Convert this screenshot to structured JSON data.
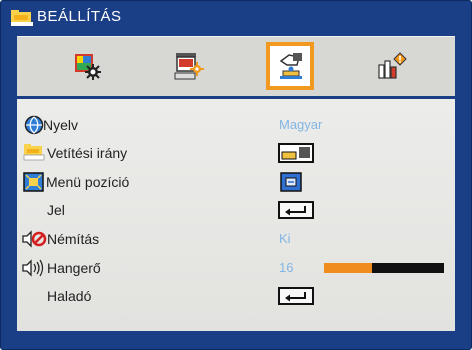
{
  "header": {
    "title": "BEÁLLÍTÁS",
    "icon": "setup-folder-icon"
  },
  "tabs": [
    {
      "name": "picture-tab",
      "icon": "image-settings-icon",
      "active": false
    },
    {
      "name": "display-tab",
      "icon": "screen-settings-icon",
      "active": false
    },
    {
      "name": "setup-tab",
      "icon": "hand-settings-icon",
      "active": true
    },
    {
      "name": "options-tab",
      "icon": "info-bars-icon",
      "active": false
    }
  ],
  "menu": {
    "language": {
      "label": "Nyelv",
      "value": "Magyar"
    },
    "projection": {
      "label": "Vetítési irány"
    },
    "menu_location": {
      "label": "Menü pozíció"
    },
    "signal": {
      "label": "Jel"
    },
    "mute": {
      "label": "Némítás",
      "value": "Ki"
    },
    "volume": {
      "label": "Hangerő",
      "value": "16",
      "level_percent": 40
    },
    "advanced": {
      "label": "Haladó"
    }
  },
  "colors": {
    "background": "#1a3f86",
    "accent": "#f29a1f",
    "value_text": "#82b6e4",
    "panel": "#e6e6e3"
  }
}
